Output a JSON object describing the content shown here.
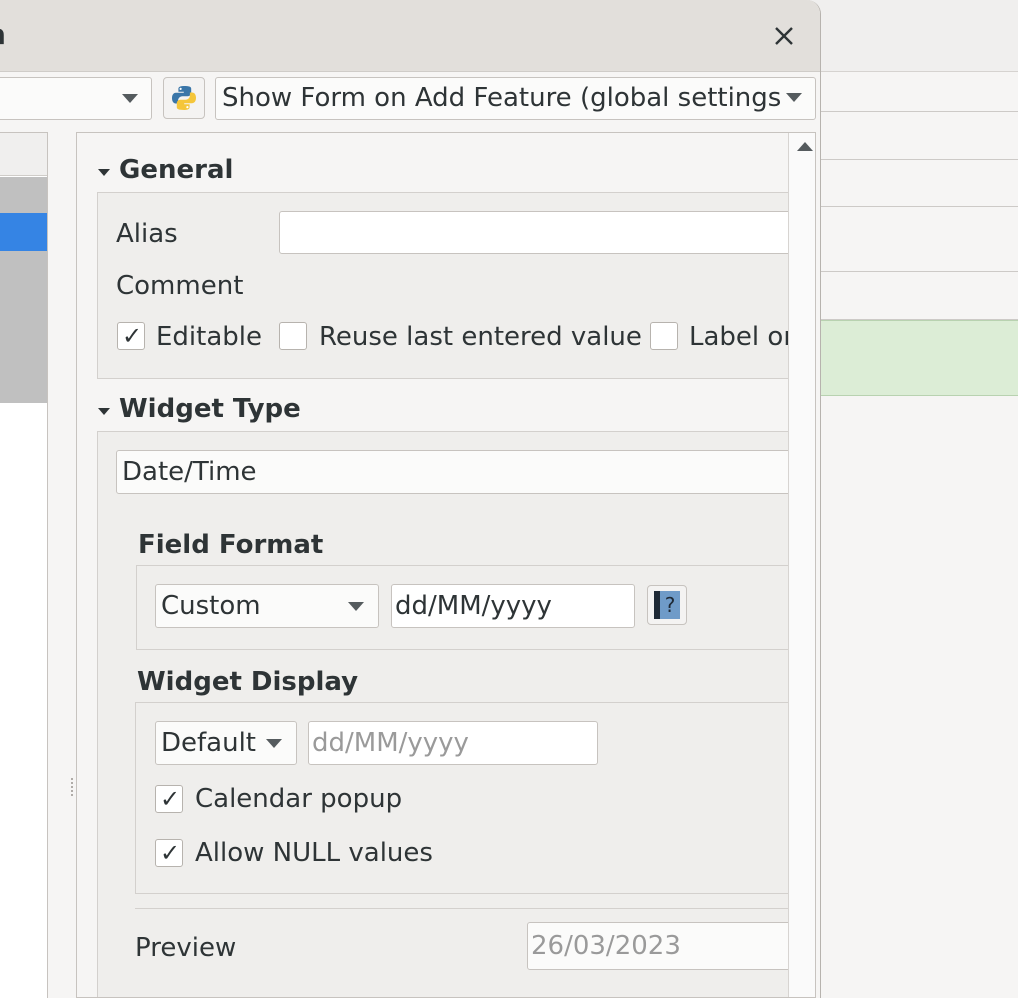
{
  "dialog": {
    "title": "n",
    "close_label": "×"
  },
  "toolbar": {
    "suppress_form_value": "Show Form on Add Feature (global settings"
  },
  "general": {
    "title": "General",
    "alias_label": "Alias",
    "alias_value": "",
    "comment_label": "Comment",
    "editable_label": "Editable",
    "editable_checked": true,
    "reuse_label": "Reuse last entered value",
    "reuse_checked": false,
    "label_on_top_label": "Label or",
    "label_on_top_checked": false
  },
  "widget_type": {
    "title": "Widget Type",
    "selected": "Date/Time"
  },
  "field_format": {
    "title": "Field Format",
    "format_selected": "Custom",
    "format_value": "dd/MM/yyyy",
    "help_glyph": "?"
  },
  "widget_display": {
    "title": "Widget Display",
    "display_selected": "Default",
    "display_placeholder": "dd/MM/yyyy",
    "calendar_popup_label": "Calendar popup",
    "calendar_popup_checked": true,
    "allow_null_label": "Allow NULL values",
    "allow_null_checked": true
  },
  "preview": {
    "label": "Preview",
    "value": "26/03/2023"
  },
  "icons": {
    "python": "python-icon",
    "help": "help-book-icon",
    "close": "close-icon"
  },
  "colors": {
    "selection": "#3584e4",
    "highlight_row": "#dcedd6"
  }
}
